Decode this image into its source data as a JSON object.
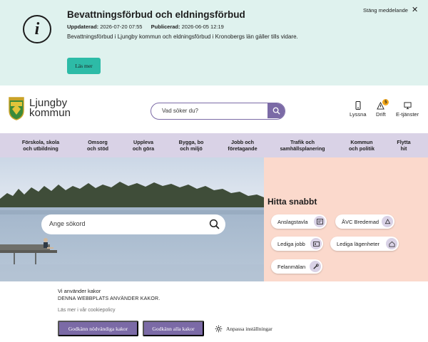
{
  "alert": {
    "title": "Bevattningsförbud och eldningsförbud",
    "updated_label": "Uppdaterad:",
    "updated_value": "2026-07-20 07:55",
    "published_label": "Publicerad:",
    "published_value": "2026-06-05 12:19",
    "body": "Bevattningsförbud i Ljungby kommun och eldningsförbud i Kronobergs län gäller tills vidare.",
    "read_more": "Läs mer",
    "close_label": "Stäng meddelande",
    "icon": "info-icon"
  },
  "header": {
    "logo_line1": "Ljungby",
    "logo_line2": "kommun",
    "search_placeholder": "Vad söker du?",
    "tools": [
      {
        "label": "Lyssna",
        "icon": "phone-icon"
      },
      {
        "label": "Drift",
        "icon": "warning-icon",
        "badge": "5"
      },
      {
        "label": "E-tjänster",
        "icon": "computer-icon"
      }
    ]
  },
  "nav": {
    "items": [
      {
        "line1": "Förskola, skola",
        "line2": "och utbildning"
      },
      {
        "line1": "Omsorg",
        "line2": "och stöd"
      },
      {
        "line1": "Uppleva",
        "line2": "och göra"
      },
      {
        "line1": "Bygga, bo",
        "line2": "och miljö"
      },
      {
        "line1": "Jobb och",
        "line2": "företagande"
      },
      {
        "line1": "Trafik och",
        "line2": "samhällsplanering"
      },
      {
        "line1": "Kommun",
        "line2": "och politik"
      },
      {
        "line1": "Flytta",
        "line2": "hit"
      }
    ]
  },
  "hero": {
    "search_placeholder": "Ange sökord"
  },
  "quick": {
    "title": "Hitta snabbt",
    "links": [
      {
        "label": "Anslagstavla",
        "icon": "board-icon"
      },
      {
        "label": "ÅVC Bredemad",
        "icon": "recycle-icon"
      },
      {
        "label": "Lediga jobb",
        "icon": "id-card-icon"
      },
      {
        "label": "Lediga lägenheter",
        "icon": "house-icon"
      },
      {
        "label": "Felanmälan",
        "icon": "wrench-icon"
      }
    ]
  },
  "cookie": {
    "title": "Vi använder kakor",
    "subtitle": "DENNA WEBBPLATS ANVÄNDER KAKOR.",
    "link": "Läs mer i vår cookiepolicy",
    "accept_necessary": "Godkänn nödvändiga kakor",
    "accept_all": "Godkänn alla kakor",
    "customize": "Anpassa inställningar"
  },
  "colors": {
    "alert_bg": "#dff2ee",
    "accent_teal": "#2dbba7",
    "brand_purple": "#7b6aa6",
    "nav_bg": "#d9d2e6",
    "quick_bg": "#fbd9cc",
    "badge": "#f3a81b"
  }
}
